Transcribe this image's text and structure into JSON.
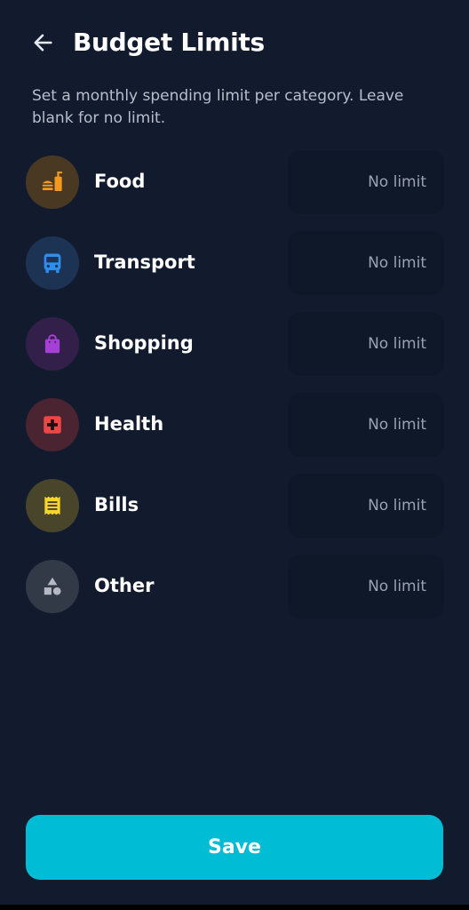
{
  "header": {
    "title": "Budget Limits",
    "back_icon": "arrow-left-icon"
  },
  "subtitle": "Set a monthly spending limit per category. Leave blank for no limit.",
  "categories": [
    {
      "label": "Food",
      "icon": "fastfood-icon",
      "icon_color": "#f39a1e",
      "bg_color": "#4a3922",
      "placeholder": "No limit",
      "value": ""
    },
    {
      "label": "Transport",
      "icon": "bus-icon",
      "icon_color": "#2b8ef0",
      "bg_color": "#1d3354",
      "placeholder": "No limit",
      "value": ""
    },
    {
      "label": "Shopping",
      "icon": "shopping-bag-icon",
      "icon_color": "#a540d6",
      "bg_color": "#33204a",
      "placeholder": "No limit",
      "value": ""
    },
    {
      "label": "Health",
      "icon": "medical-cross-icon",
      "icon_color": "#ef4545",
      "bg_color": "#4a2430",
      "placeholder": "No limit",
      "value": ""
    },
    {
      "label": "Bills",
      "icon": "receipt-icon",
      "icon_color": "#f5d52a",
      "bg_color": "#48452b",
      "placeholder": "No limit",
      "value": ""
    },
    {
      "label": "Other",
      "icon": "shapes-icon",
      "icon_color": "#b4b9c3",
      "bg_color": "#323947",
      "placeholder": "No limit",
      "value": ""
    }
  ],
  "save_label": "Save",
  "colors": {
    "background": "#121b2d",
    "accent": "#00bcd4",
    "input_bg": "#0f1828"
  }
}
